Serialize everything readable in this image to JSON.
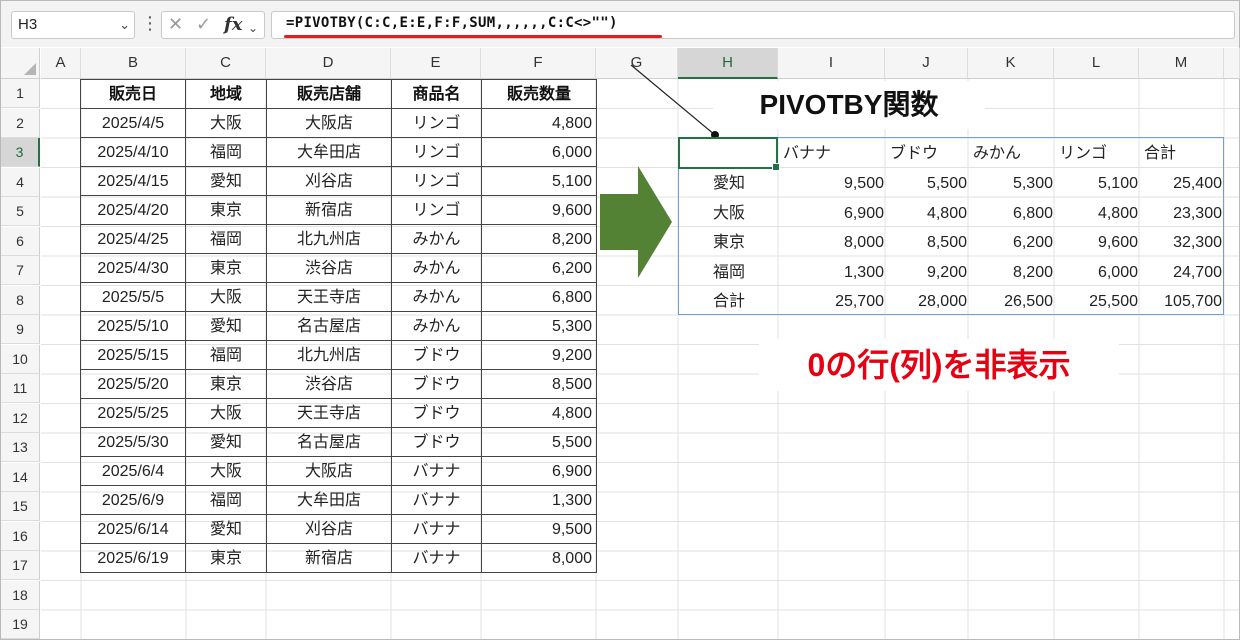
{
  "formula_bar": {
    "name_box": "H3",
    "formula": "=PIVOTBY(C:C,E:E,F:F,SUM,,,,,,C:C<>\"\")",
    "fx_label": "fx"
  },
  "columns": [
    "A",
    "B",
    "C",
    "D",
    "E",
    "F",
    "G",
    "H",
    "I",
    "J",
    "K",
    "L",
    "M"
  ],
  "rows": [
    "1",
    "2",
    "3",
    "4",
    "5",
    "6",
    "7",
    "8",
    "9",
    "10",
    "11",
    "12",
    "13",
    "14",
    "15",
    "16",
    "17",
    "18",
    "19"
  ],
  "source_table": {
    "headers": [
      "販売日",
      "地域",
      "販売店舗",
      "商品名",
      "販売数量"
    ],
    "rows": [
      [
        "2025/4/5",
        "大阪",
        "大阪店",
        "リンゴ",
        "4,800"
      ],
      [
        "2025/4/10",
        "福岡",
        "大牟田店",
        "リンゴ",
        "6,000"
      ],
      [
        "2025/4/15",
        "愛知",
        "刈谷店",
        "リンゴ",
        "5,100"
      ],
      [
        "2025/4/20",
        "東京",
        "新宿店",
        "リンゴ",
        "9,600"
      ],
      [
        "2025/4/25",
        "福岡",
        "北九州店",
        "みかん",
        "8,200"
      ],
      [
        "2025/4/30",
        "東京",
        "渋谷店",
        "みかん",
        "6,200"
      ],
      [
        "2025/5/5",
        "大阪",
        "天王寺店",
        "みかん",
        "6,800"
      ],
      [
        "2025/5/10",
        "愛知",
        "名古屋店",
        "みかん",
        "5,300"
      ],
      [
        "2025/5/15",
        "福岡",
        "北九州店",
        "ブドウ",
        "9,200"
      ],
      [
        "2025/5/20",
        "東京",
        "渋谷店",
        "ブドウ",
        "8,500"
      ],
      [
        "2025/5/25",
        "大阪",
        "天王寺店",
        "ブドウ",
        "4,800"
      ],
      [
        "2025/5/30",
        "愛知",
        "名古屋店",
        "ブドウ",
        "5,500"
      ],
      [
        "2025/6/4",
        "大阪",
        "大阪店",
        "バナナ",
        "6,900"
      ],
      [
        "2025/6/9",
        "福岡",
        "大牟田店",
        "バナナ",
        "1,300"
      ],
      [
        "2025/6/14",
        "愛知",
        "刈谷店",
        "バナナ",
        "9,500"
      ],
      [
        "2025/6/19",
        "東京",
        "新宿店",
        "バナナ",
        "8,000"
      ]
    ]
  },
  "pivot": {
    "headers": [
      "",
      "バナナ",
      "ブドウ",
      "みかん",
      "リンゴ",
      "合計"
    ],
    "rows": [
      [
        "愛知",
        "9,500",
        "5,500",
        "5,300",
        "5,100",
        "25,400"
      ],
      [
        "大阪",
        "6,900",
        "4,800",
        "6,800",
        "4,800",
        "23,300"
      ],
      [
        "東京",
        "8,000",
        "8,500",
        "6,200",
        "9,600",
        "32,300"
      ],
      [
        "福岡",
        "1,300",
        "9,200",
        "8,200",
        "6,000",
        "24,700"
      ],
      [
        "合計",
        "25,700",
        "28,000",
        "26,500",
        "25,500",
        "105,700"
      ]
    ]
  },
  "callouts": {
    "title": "PIVOTBY関数",
    "note": "0の行(列)を非表示"
  },
  "colors": {
    "accent_green": "#217346",
    "arrow_green": "#548235",
    "highlight_red": "#e60012",
    "pivot_border": "#6f9fd8"
  }
}
